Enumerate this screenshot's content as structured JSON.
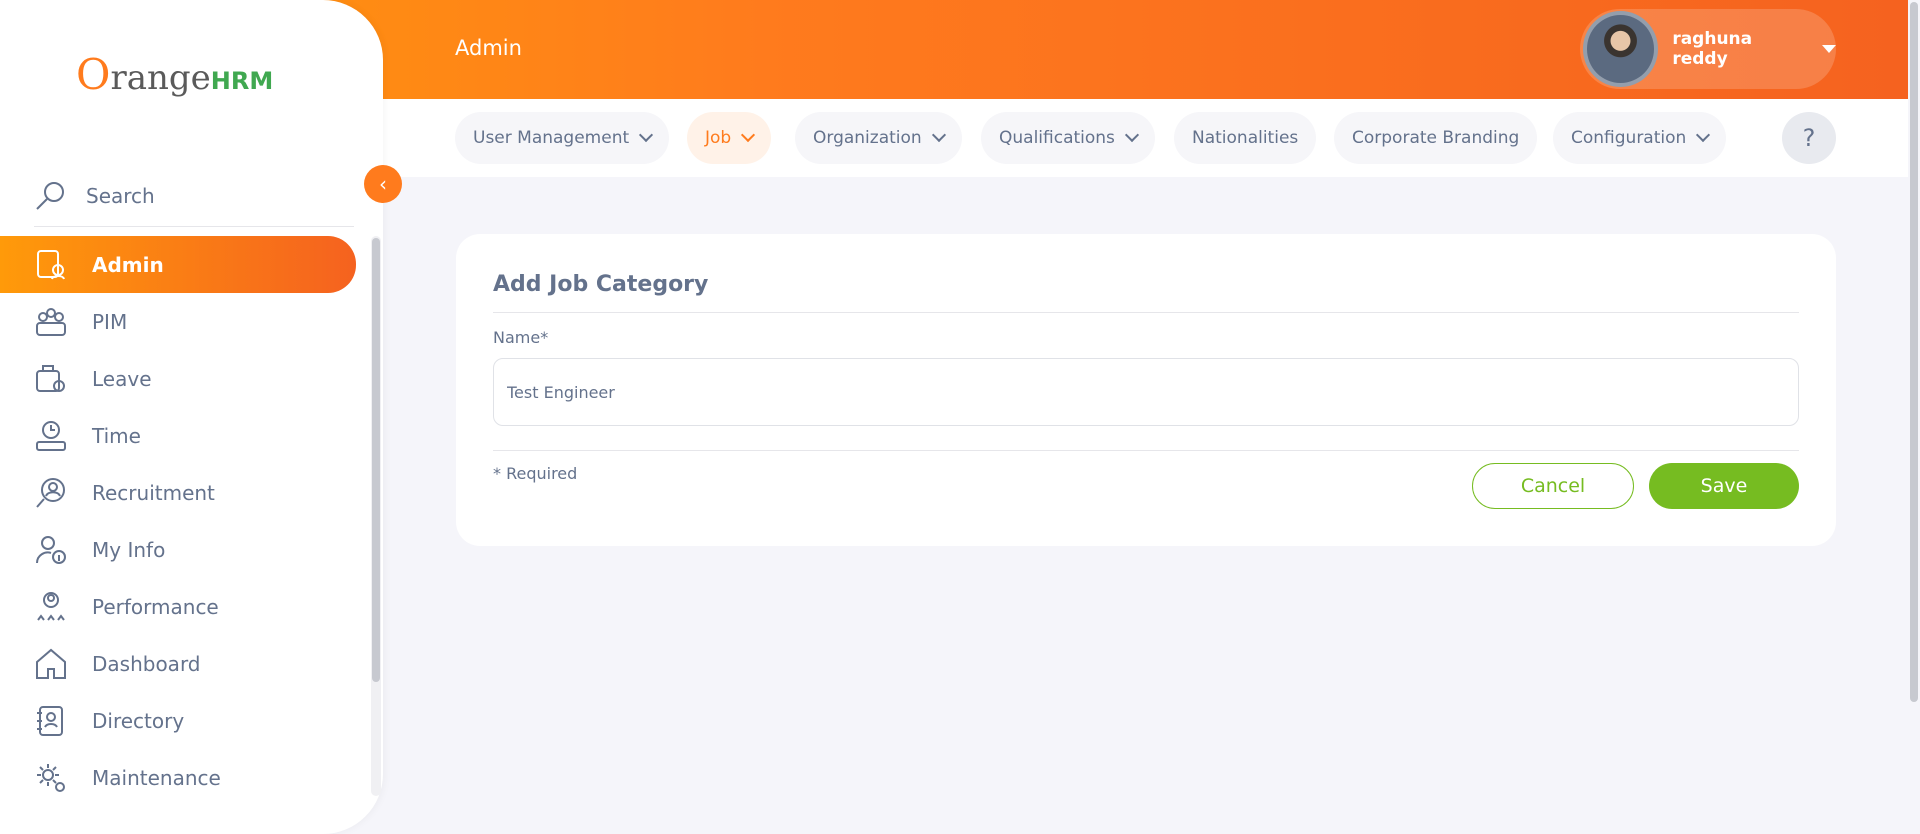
{
  "header": {
    "module_title": "Admin",
    "user_name": "raghuna reddy"
  },
  "subnav": {
    "tabs": [
      {
        "label": "User Management",
        "has_dropdown": true
      },
      {
        "label": "Job",
        "has_dropdown": true,
        "active": true
      },
      {
        "label": "Organization",
        "has_dropdown": true
      },
      {
        "label": "Qualifications",
        "has_dropdown": true
      },
      {
        "label": "Nationalities",
        "has_dropdown": false
      },
      {
        "label": "Corporate Branding",
        "has_dropdown": false
      },
      {
        "label": "Configuration",
        "has_dropdown": true
      }
    ],
    "help_label": "?"
  },
  "sidebar": {
    "logo": {
      "o": "O",
      "range": "range",
      "hrm": "HRM"
    },
    "search_label": "Search",
    "collapse_icon": "‹",
    "items": [
      {
        "label": "Admin",
        "icon": "admin-icon",
        "active": true
      },
      {
        "label": "PIM",
        "icon": "pim-icon"
      },
      {
        "label": "Leave",
        "icon": "leave-icon"
      },
      {
        "label": "Time",
        "icon": "time-icon"
      },
      {
        "label": "Recruitment",
        "icon": "recruitment-icon"
      },
      {
        "label": "My Info",
        "icon": "my-info-icon"
      },
      {
        "label": "Performance",
        "icon": "performance-icon"
      },
      {
        "label": "Dashboard",
        "icon": "dashboard-icon"
      },
      {
        "label": "Directory",
        "icon": "directory-icon"
      },
      {
        "label": "Maintenance",
        "icon": "maintenance-icon"
      }
    ]
  },
  "form": {
    "title": "Add Job Category",
    "name_label": "Name*",
    "name_value": "Test Engineer",
    "required_note": "* Required",
    "cancel_label": "Cancel",
    "save_label": "Save"
  },
  "colors": {
    "brand_orange": "#ff7b1d",
    "save_green": "#76bc21",
    "text_gray": "#64728c"
  }
}
